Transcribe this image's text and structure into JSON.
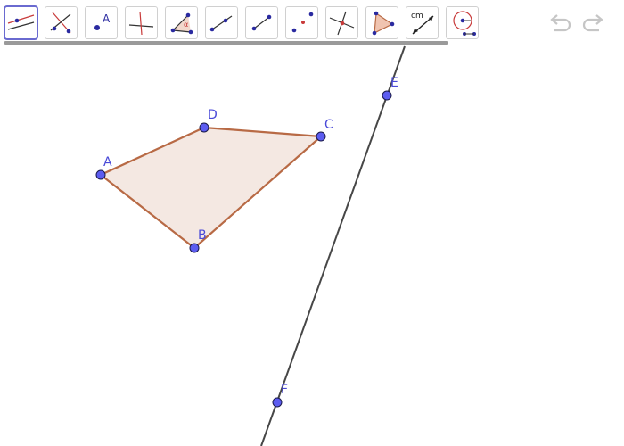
{
  "toolbar": {
    "tools": [
      {
        "name": "line-tool",
        "selected": true
      },
      {
        "name": "perpendicular-tool"
      },
      {
        "name": "point-tool",
        "label": "A"
      },
      {
        "name": "perpendicular-bisector-tool"
      },
      {
        "name": "angle-tool",
        "label": "α"
      },
      {
        "name": "segment-tool"
      },
      {
        "name": "segment-tool-2"
      },
      {
        "name": "midpoint-tool"
      },
      {
        "name": "intersect-tool"
      },
      {
        "name": "polygon-tool"
      },
      {
        "name": "distance-tool",
        "label": "cm"
      },
      {
        "name": "circle-tool"
      }
    ],
    "undo_icon": "undo-icon",
    "redo_icon": "redo-icon"
  },
  "canvas": {
    "points": [
      {
        "label": "A"
      },
      {
        "label": "B"
      },
      {
        "label": "C"
      },
      {
        "label": "D"
      },
      {
        "label": "E"
      },
      {
        "label": "F"
      }
    ],
    "colors": {
      "point_fill": "#5c5cf0",
      "point_stroke": "#1a1a4a",
      "label": "#4a4ad8",
      "polygon_fill": "#f4e8e2",
      "polygon_stroke": "#b86a45",
      "line": "#474747"
    }
  }
}
